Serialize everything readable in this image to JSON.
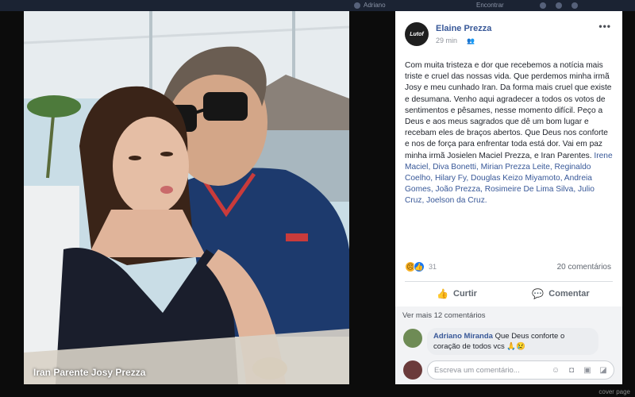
{
  "topbar": {
    "user_name": "Adriano",
    "right_item": "Encontrar"
  },
  "photo": {
    "caption": "Iran Parente Josy Prezza"
  },
  "post": {
    "author": "Elaine Prezza",
    "avatar_text": "Lutof",
    "time": "29 min",
    "text_main": "Com muita tristeza e dor que recebemos a notícia mais triste e cruel das nossas vida. Que perdemos minha irmã Josy e meu cunhado Iran. Da forma mais cruel que existe e desumana. Venho aqui agradecer a todos os votos de sentimentos e pêsames, nesse momento difícil. Peço a Deus e aos meus sagrados que dê um bom lugar e recebam eles de braços abertos. Que Deus nos conforte e nos de força para enfrentar toda está dor. Vai em paz minha irmã Josielen Maciel Prezza, e Iran Parentes.",
    "text_tags": "Irene Maciel, Diva Bonetti, Mirian Prezza Leite, Reginaldo Coelho, Hilary Fy, Douglas Keizo Miyamoto, Andreia Gomes, João Prezza, Rosimeire De Lima Silva, Julio Cruz, Joelson da Cruz.",
    "reaction_count": "31",
    "comments_count": "20 comentários"
  },
  "actions": {
    "like": "Curtir",
    "comment": "Comentar"
  },
  "comments": {
    "more_label": "Ver mais 12 comentários",
    "items": [
      {
        "author": "Adriano Miranda",
        "text": "Que Deus conforte o coração de todos vcs 🙏😢"
      }
    ],
    "reply_placeholder": "Escreva um comentário..."
  },
  "icons": {
    "audience": "friends-icon",
    "more": "more-options-icon",
    "sad": "sad-reaction-icon",
    "like": "like-reaction-icon"
  },
  "watermark": "cover page",
  "colors": {
    "link": "#385898",
    "like_blue": "#1877f2",
    "sad_yellow": "#f7b125"
  }
}
